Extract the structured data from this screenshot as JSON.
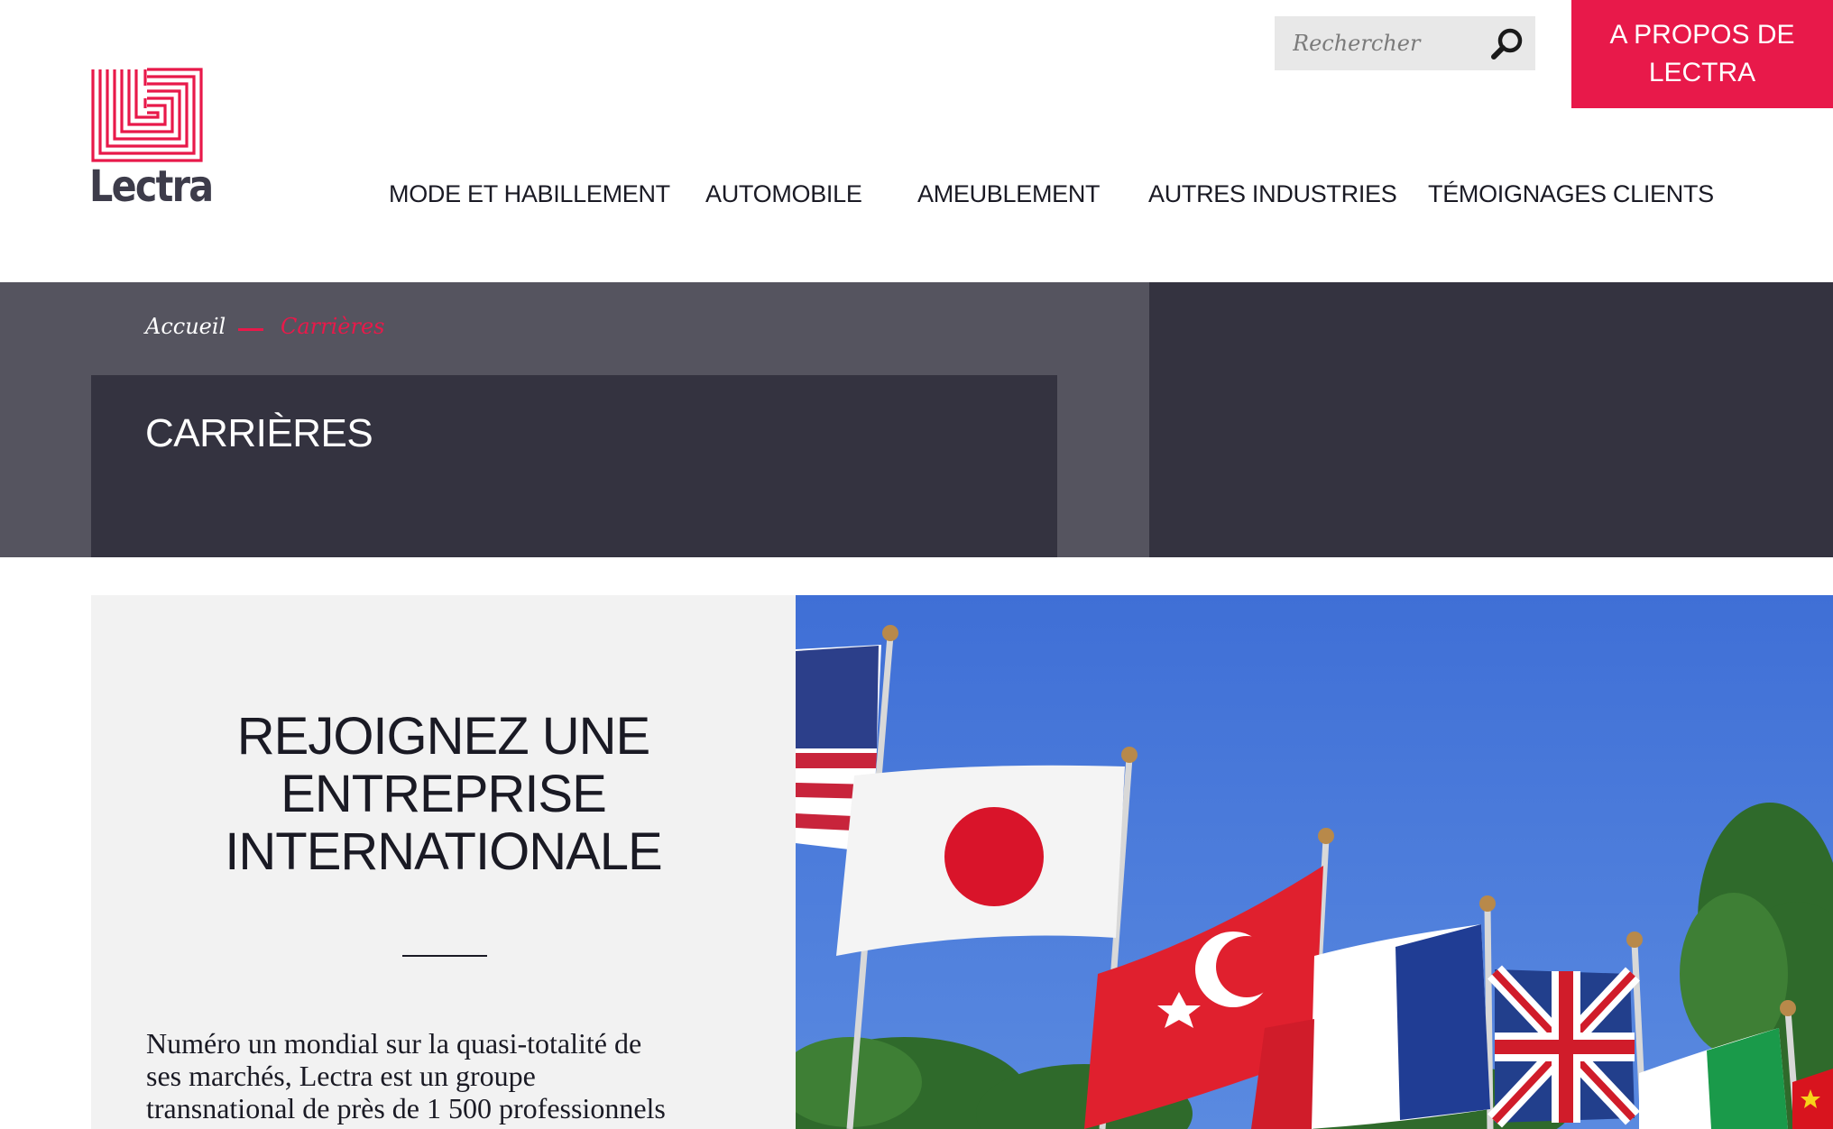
{
  "header": {
    "logo_text": "Lectra",
    "search_placeholder": "Rechercher",
    "about_button": [
      "A PROPOS DE",
      "LECTRA"
    ],
    "nav": [
      "MODE ET HABILLEMENT",
      "AUTOMOBILE",
      "AMEUBLEMENT",
      "AUTRES INDUSTRIES",
      "TÉMOIGNAGES CLIENTS"
    ]
  },
  "breadcrumb": {
    "home": "Accueil",
    "current": "Carrières"
  },
  "page_title": "CARRIÈRES",
  "content": {
    "headline": [
      "REJOIGNEZ UNE",
      "ENTREPRISE",
      "INTERNATIONALE"
    ],
    "body_lines": [
      "Numéro un mondial sur la quasi-totalité de",
      "ses marchés, Lectra est un groupe",
      "transnational de près de 1 500 professionnels"
    ]
  },
  "colors": {
    "accent": "#e8194a",
    "hero_light": "#55545f",
    "hero_dark": "#343340",
    "text_dark": "#1a1a24"
  },
  "icons": {
    "search": "search-icon",
    "logo": "lectra-logo-icon"
  }
}
